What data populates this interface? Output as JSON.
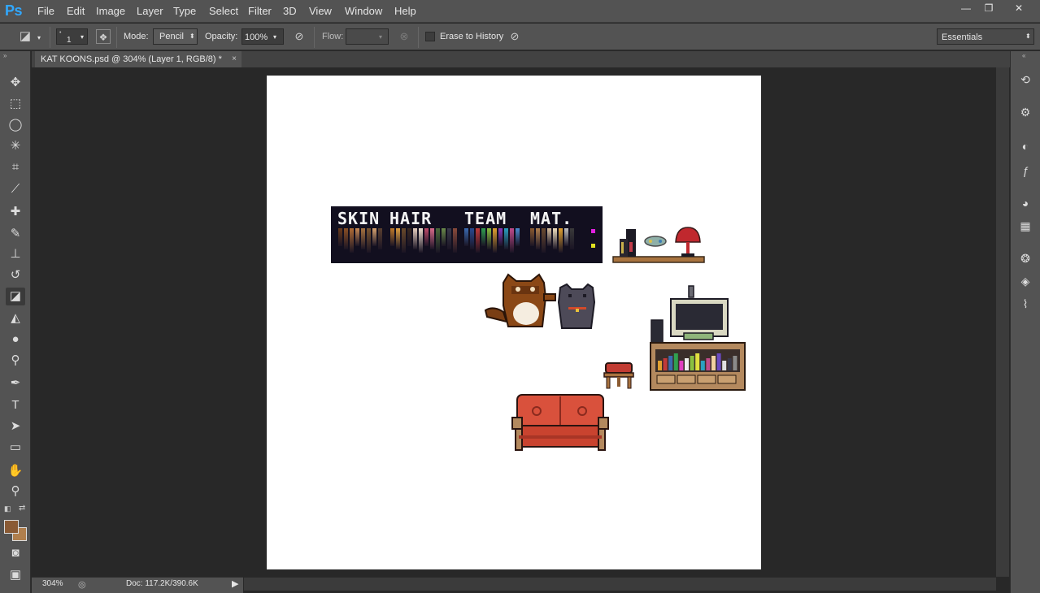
{
  "app": {
    "logo": "Ps"
  },
  "menu": [
    "File",
    "Edit",
    "Image",
    "Layer",
    "Type",
    "Select",
    "Filter",
    "3D",
    "View",
    "Window",
    "Help"
  ],
  "window_controls": {
    "minimize": "—",
    "restore": "❐",
    "close": "✕"
  },
  "options": {
    "brush_size": "1",
    "mode_label": "Mode:",
    "mode_value": "Pencil",
    "opacity_label": "Opacity:",
    "opacity_value": "100%",
    "flow_label": "Flow:",
    "erase_history_label": "Erase to History",
    "workspace": "Essentials"
  },
  "document": {
    "tab_title": "KAT KOONS.psd @ 304% (Layer 1, RGB/8) *",
    "tab_close": "×"
  },
  "status": {
    "zoom": "304%",
    "doc_size": "Doc: 117.2K/390.6K"
  },
  "artwork": {
    "palette_labels": [
      "SKIN",
      "HAIR",
      "TEAM",
      "MAT."
    ]
  },
  "colors": {
    "foreground": "#8a5a34",
    "background": "#b07f4d",
    "accent": "#31a8ff"
  }
}
